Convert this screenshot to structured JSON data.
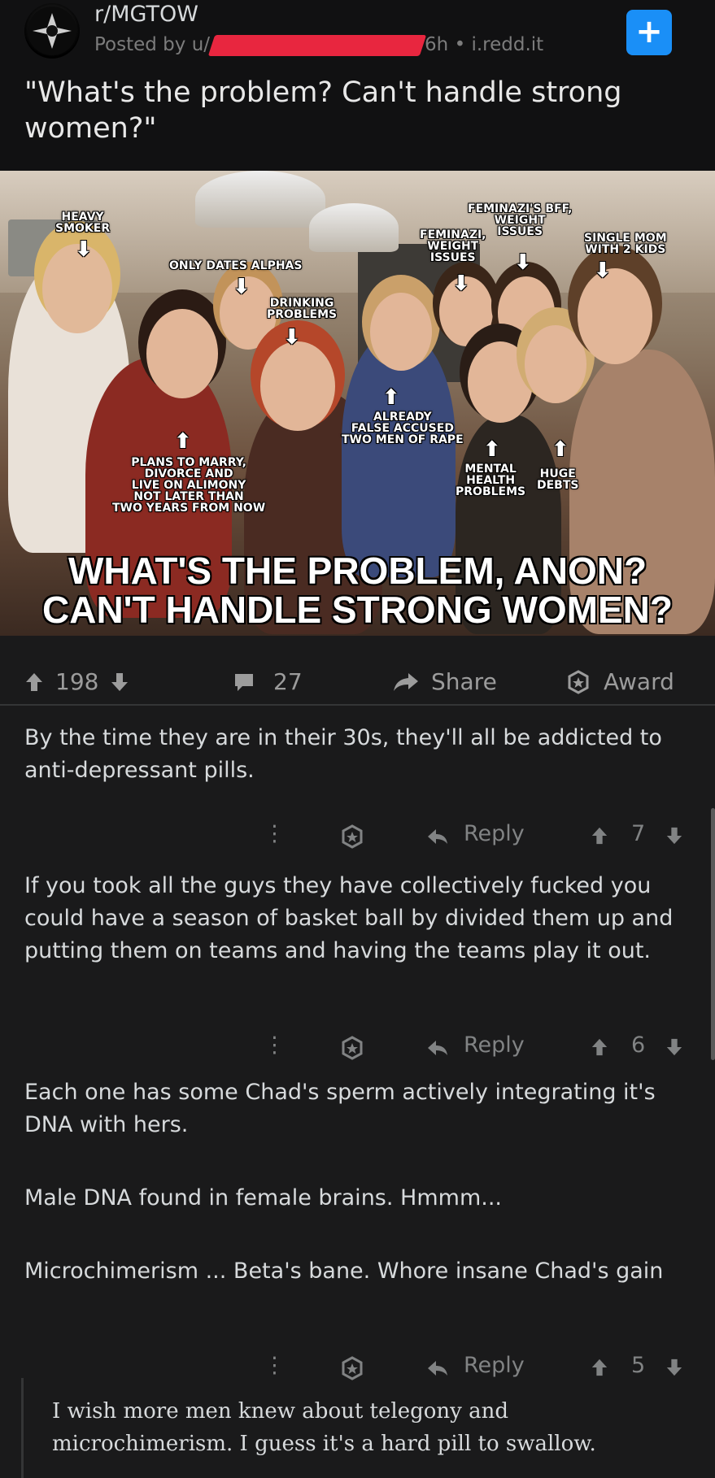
{
  "post": {
    "subreddit": "r/MGTOW",
    "posted_prefix": "Posted by u/",
    "posted_suffix": "6h • i.redd.it",
    "title": "\"What's the problem? Can't handle strong women?\"",
    "join_label": "+"
  },
  "image": {
    "labels": {
      "heavy_smoker": "HEAVY\nSMOKER",
      "only_dates_alphas": "ONLY DATES ALPHAS",
      "drinking_problems": "DRINKING\nPROBLEMS",
      "feminazis_bff": "FEMINAZI'S BFF,\nWEIGHT\nISSUES",
      "feminazi_weight": "FEMINAZI,\nWEIGHT\nISSUES",
      "single_mom": "SINGLE MOM\nWITH 2 KIDS",
      "plans_to_marry": "PLANS TO MARRY,\nDIVORCE AND\nLIVE ON ALIMONY\nNOT LATER THAN\nTWO YEARS FROM NOW",
      "already_false_accused": "ALREADY\nFALSE ACCUSED\nTWO MEN OF RAPE",
      "mental_health": "MENTAL\nHEALTH\nPROBLEMS",
      "huge_debts": "HUGE\nDEBTS"
    },
    "caption_line1": "WHAT'S THE PROBLEM, ANON?",
    "caption_line2": "CAN'T HANDLE STRONG WOMEN?"
  },
  "actions": {
    "upvotes": "198",
    "comments": "27",
    "share": "Share",
    "award": "Award"
  },
  "comments": [
    {
      "text": "By the time they are in their 30s, they'll all be addicted to anti-depressant pills.",
      "reply": "Reply",
      "score": "7"
    },
    {
      "text": "If you took all the guys they have collectively fucked you could have a season of basket ball by divided them up and putting them on teams and having the teams play it out.",
      "reply": "Reply",
      "score": "6"
    },
    {
      "text_lines": [
        "Each one has some Chad's sperm actively integrating it's DNA with hers.",
        "Male DNA found in female brains. Hmmm...",
        "Microchimerism ... Beta's bane. Whore insane Chad's gain"
      ],
      "reply": "Reply",
      "score": "5"
    },
    {
      "text": "I wish more men knew about telegony and microchimerism. I guess it's a hard pill to swallow."
    }
  ],
  "colors": {
    "background": "#1a1a1b",
    "header_background": "#111112",
    "accent_blue": "#1a8ff7",
    "text": "#d7dadc",
    "muted": "#818384"
  }
}
